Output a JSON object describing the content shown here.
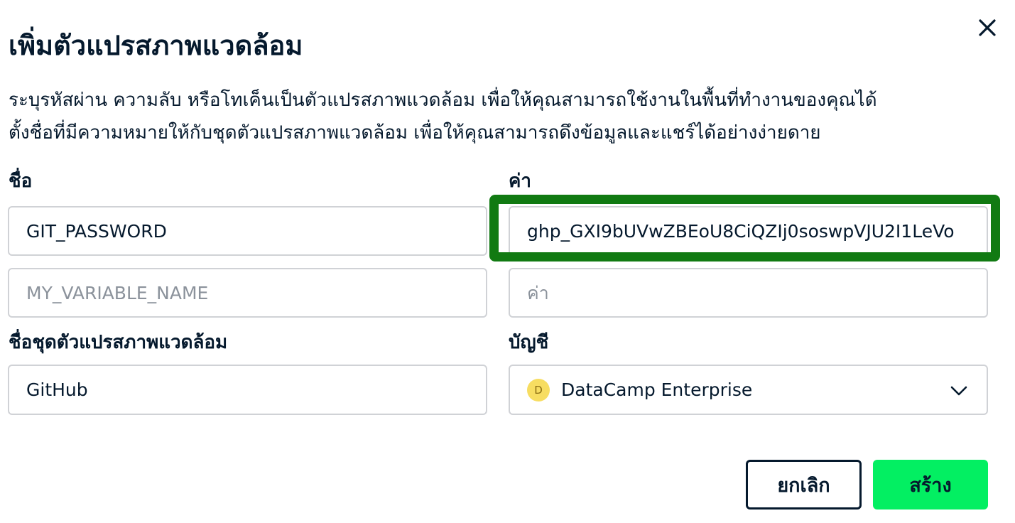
{
  "dialog": {
    "title": "เพิ่มตัวแปรสภาพแวดล้อม",
    "description_line1": "ระบุรหัสผ่าน ความลับ หรือโทเค็นเป็นตัวแปรสภาพแวดล้อม เพื่อให้คุณสามารถใช้งานในพื้นที่ทำงานของคุณได้",
    "description_line2": "ตั้งชื่อที่มีความหมายให้กับชุดตัวแปรสภาพแวดล้อม เพื่อให้คุณสามารถดึงข้อมูลและแชร์ได้อย่างง่ายดาย",
    "close_icon": "close-icon"
  },
  "variables": {
    "name_label": "ชื่อ",
    "value_label": "ค่า",
    "rows": [
      {
        "name": "GIT_PASSWORD",
        "name_placeholder": "",
        "value": "ghp_GXI9bUVwZBEoU8CiQZIj0soswpVJU2I1LeVo",
        "value_placeholder": ""
      },
      {
        "name": "",
        "name_placeholder": "MY_VARIABLE_NAME",
        "value": "",
        "value_placeholder": "ค่า"
      }
    ]
  },
  "set": {
    "name_label": "ชื่อชุดตัวแปรสภาพแวดล้อม",
    "name_value": "GitHub"
  },
  "account": {
    "label": "บัญชี",
    "avatar_letter": "D",
    "selected": "DataCamp Enterprise",
    "avatar_color": "#f7dd61"
  },
  "actions": {
    "cancel_label": "ยกเลิก",
    "create_label": "สร้าง",
    "create_color": "#03ef62"
  },
  "colors": {
    "highlight_border": "#117a12",
    "text": "#05192d"
  }
}
